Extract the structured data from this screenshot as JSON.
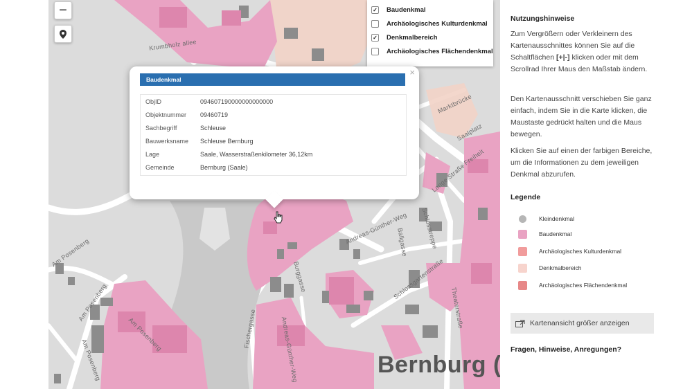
{
  "colors": {
    "kleindenkmal": "#b6b6b6",
    "baudenkmal": "#e9a3c3",
    "kulturdenkmal": "#f19c9c",
    "denkmalbereich": "#f7d4cd",
    "flaechendenkmal": "#e78888",
    "popup_header": "#2a6fb0"
  },
  "map": {
    "zoom_in_label": "+",
    "zoom_out_label": "−",
    "city_label": "Bernburg (Saale)",
    "streets": {
      "krumbholzallee": "Krumbholz allee",
      "markt": "Marktbrücke",
      "saalplatz": "Saalplatz",
      "lange_strasse": "Lange Straße",
      "freiheit": "Freiheit",
      "schlossgarten": "Schlossgartenstraße",
      "schlosstreppe": "Schlosstreppe",
      "theaterstrasse": "Theaterstraße",
      "andreas_guenther_weg": "Andreas-Günther-Weg",
      "andreas_guenther_weg_2": "Andreas-Günther-Weg",
      "ballgasse": "Ballgasse",
      "fischergasse": "Fischergasse",
      "burggasse": "Burggasse",
      "am_posenberg_1": "Am Posenberg",
      "am_posenberg_2": "Am Posenberg",
      "am_posenberg_3": "Am Posenberg",
      "am_posenberg_4": "Am Posenberg"
    }
  },
  "layers": [
    {
      "label": "Baudenkmal",
      "checked": true
    },
    {
      "label": "Archäologisches Kulturdenkmal",
      "checked": false
    },
    {
      "label": "Denkmalbereich",
      "checked": true
    },
    {
      "label": "Archäologisches Flächendenkmal",
      "checked": false
    }
  ],
  "popup": {
    "title": "Baudenkmal",
    "close_label": "×",
    "rows": [
      {
        "key": "ObjID",
        "value": "094607190000000000000"
      },
      {
        "key": "Objektnummer",
        "value": "09460719"
      },
      {
        "key": "Sachbegriff",
        "value": "Schleuse"
      },
      {
        "key": "Bauwerksname",
        "value": "Schleuse Bernburg"
      },
      {
        "key": "Lage",
        "value": "Saale, Wasserstraßenkilometer 36,12km"
      },
      {
        "key": "Gemeinde",
        "value": "Bernburg (Saale)"
      }
    ]
  },
  "sidebar": {
    "hints_title": "Nutzungshinweise",
    "para1_a": "Zum Vergrößern oder Verkleinern des Kartenausschnittes können Sie auf die Schaltflächen ",
    "para1_keys": "[+|-]",
    "para1_b": " klicken oder mit dem Scrollrad Ihrer Maus den Maßstab ändern.",
    "para2": "Den Kartenausschnitt verschieben Sie ganz einfach, indem Sie in die Karte klicken, die Maustaste gedrückt halten und die Maus bewegen.",
    "para3": "Klicken Sie auf einen der farbigen Bereiche, um die Informationen zu dem jeweiligen Denkmal abzurufen.",
    "legend_title": "Legende",
    "legend": [
      {
        "label": "Kleindenkmal"
      },
      {
        "label": "Baudenkmal"
      },
      {
        "label": "Archäologisches Kulturdenkmal"
      },
      {
        "label": "Denkmalbereich"
      },
      {
        "label": "Archäologisches Flächendenkmal"
      }
    ],
    "bigger_map_label": "Kartenansicht größer anzeigen",
    "questions_title": "Fragen, Hinweise, Anregungen?"
  }
}
